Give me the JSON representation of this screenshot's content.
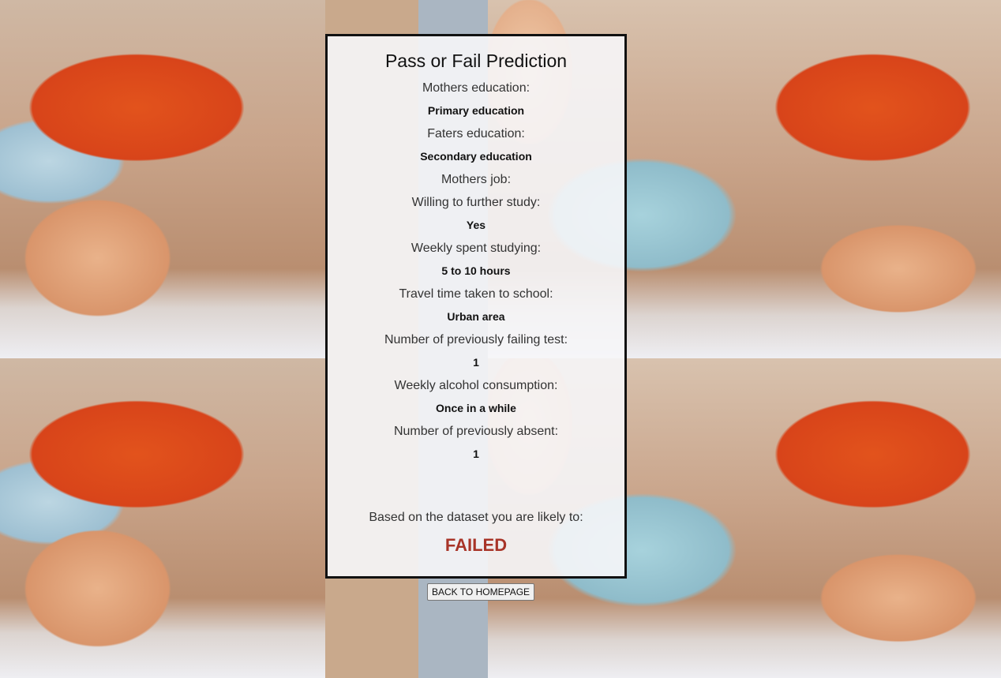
{
  "title": "Pass or Fail Prediction",
  "fields": [
    {
      "label": "Mothers education:",
      "value": "Primary education"
    },
    {
      "label": "Faters education:",
      "value": "Secondary education"
    },
    {
      "label": "Mothers job:",
      "value": ""
    },
    {
      "label": "Willing to further study:",
      "value": "Yes"
    },
    {
      "label": "Weekly spent studying:",
      "value": "5 to 10 hours"
    },
    {
      "label": "Travel time taken to school:",
      "value": "Urban area"
    },
    {
      "label": "Number of previously failing test:",
      "value": "1"
    },
    {
      "label": "Weekly alcohol consumption:",
      "value": "Once in a while"
    },
    {
      "label": "Number of previously absent:",
      "value": "1"
    }
  ],
  "result": {
    "label": "Based on the dataset you are likely to:",
    "value": "FAILED",
    "color": "#a83428"
  },
  "back_button": "BACK TO HOMEPAGE"
}
